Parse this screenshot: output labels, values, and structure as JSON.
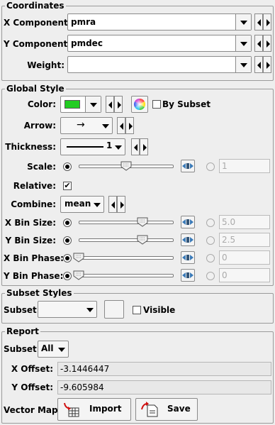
{
  "coordinates": {
    "title": "Coordinates",
    "x_label": "X Component:",
    "x_value": "pmra",
    "y_label": "Y Component:",
    "y_value": "pmdec",
    "weight_label": "Weight:",
    "weight_value": ""
  },
  "global_style": {
    "title": "Global Style",
    "color_label": "Color:",
    "color_value": "#22cc22",
    "by_subset_label": "By Subset",
    "arrow_label": "Arrow:",
    "arrow_value": "→",
    "thickness_label": "Thickness:",
    "thickness_value": "1",
    "scale_label": "Scale:",
    "scale_value": "1",
    "scale_slider_fraction": 0.5,
    "relative_label": "Relative:",
    "relative_checked": "✔",
    "combine_label": "Combine:",
    "combine_value": "mean",
    "xbin_size_label": "X Bin Size:",
    "xbin_size_value": "5.0",
    "xbin_size_fraction": 0.67,
    "ybin_size_label": "Y Bin Size:",
    "ybin_size_value": "2.5",
    "ybin_size_fraction": 0.67,
    "xbin_phase_label": "X Bin Phase:",
    "xbin_phase_value": "0",
    "xbin_phase_fraction": 0.0,
    "ybin_phase_label": "Y Bin Phase:",
    "ybin_phase_value": "0",
    "ybin_phase_fraction": 0.0
  },
  "subset_styles": {
    "title": "Subset Styles",
    "subset_label": "Subset:",
    "subset_value": "",
    "visible_label": "Visible"
  },
  "report": {
    "title": "Report",
    "subset_label": "Subset:",
    "subset_value": "All",
    "x_offset_label": "X Offset:",
    "x_offset_value": "-3.1446447",
    "y_offset_label": "Y Offset:",
    "y_offset_value": "-9.605984",
    "vector_map_label": "Vector Map:",
    "import_label": "Import",
    "save_label": "Save"
  },
  "icons": [
    "dropdown-arrow-icon",
    "step-left-icon",
    "step-right-icon",
    "color-wheel-icon",
    "slider-thumb-icon",
    "reset-slider-icon",
    "import-icon",
    "save-icon"
  ]
}
